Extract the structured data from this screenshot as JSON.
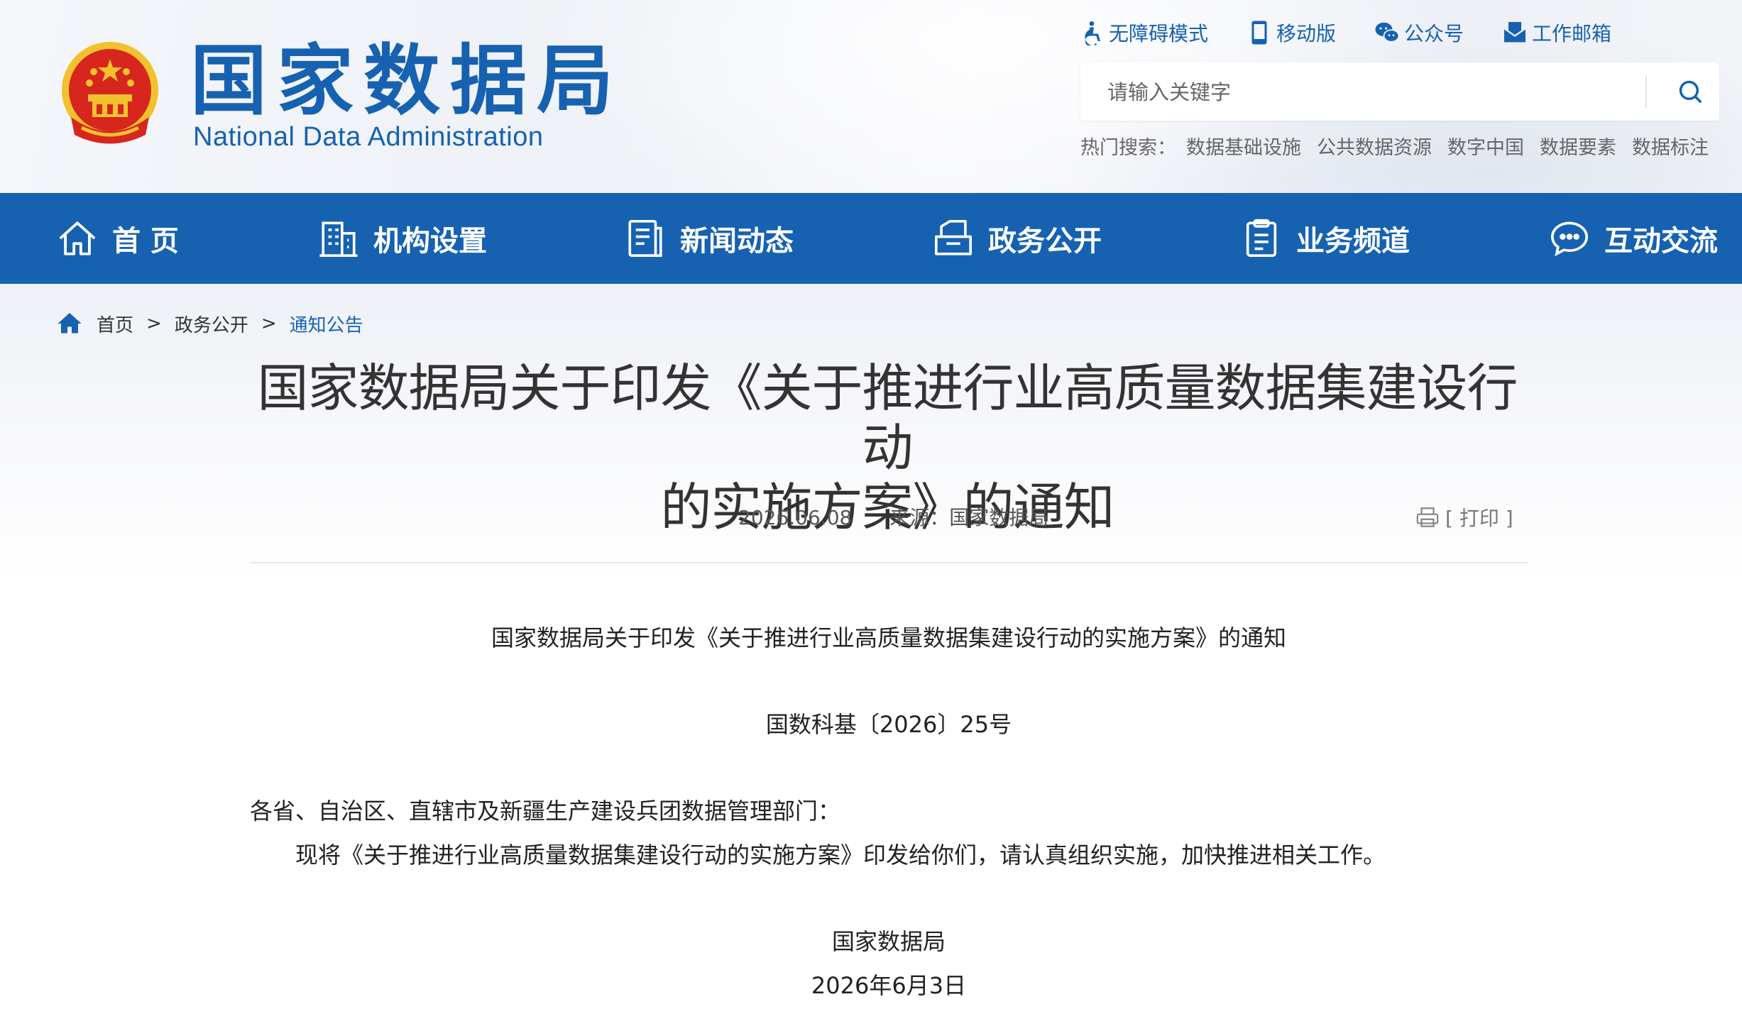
{
  "header": {
    "logo_cn": "国家数据局",
    "logo_en": "National Data Administration",
    "top_links": [
      {
        "label": "无障碍模式",
        "icon": "accessibility-icon"
      },
      {
        "label": "移动版",
        "icon": "mobile-icon"
      },
      {
        "label": "公众号",
        "icon": "wechat-icon"
      },
      {
        "label": "工作邮箱",
        "icon": "mailbox-icon"
      }
    ],
    "search": {
      "placeholder": "请输入关键字",
      "icon": "search-icon"
    },
    "hot_search": {
      "label": "热门搜索：",
      "keywords": [
        "数据基础设施",
        "公共数据资源",
        "数字中国",
        "数据要素",
        "数据标注"
      ]
    }
  },
  "nav": {
    "items": [
      {
        "label": "首 页",
        "icon": "home-icon"
      },
      {
        "label": "机构设置",
        "icon": "building-icon"
      },
      {
        "label": "新闻动态",
        "icon": "news-icon"
      },
      {
        "label": "政务公开",
        "icon": "open-affairs-icon"
      },
      {
        "label": "业务频道",
        "icon": "clipboard-icon"
      },
      {
        "label": "互动交流",
        "icon": "chat-icon"
      }
    ],
    "bg_color": "#1662b0"
  },
  "breadcrumb": {
    "items": [
      "首页",
      "政务公开",
      "通知公告"
    ],
    "separator": ">"
  },
  "article": {
    "title_line1": "国家数据局关于印发《关于推进行业高质量数据集建设行动",
    "title_line2": "的实施方案》的通知",
    "date": "2026.06.08",
    "source": "来源：国家数据局",
    "print_label": "[ 打印 ]",
    "subtitle": "国家数据局关于印发《关于推进行业高质量数据集建设行动的实施方案》的通知",
    "doc_number": "国数科基〔2026〕25号",
    "addressee": "各省、自治区、直辖市及新疆生产建设兵团数据管理部门：",
    "body": "现将《关于推进行业高质量数据集建设行动的实施方案》印发给你们，请认真组织实施，加快推进相关工作。",
    "signature": "国家数据局",
    "sign_date": "2026年6月3日"
  },
  "colors": {
    "brand_blue": "#1662b0",
    "emblem_red": "#d7261e",
    "emblem_gold": "#f2c12e"
  }
}
